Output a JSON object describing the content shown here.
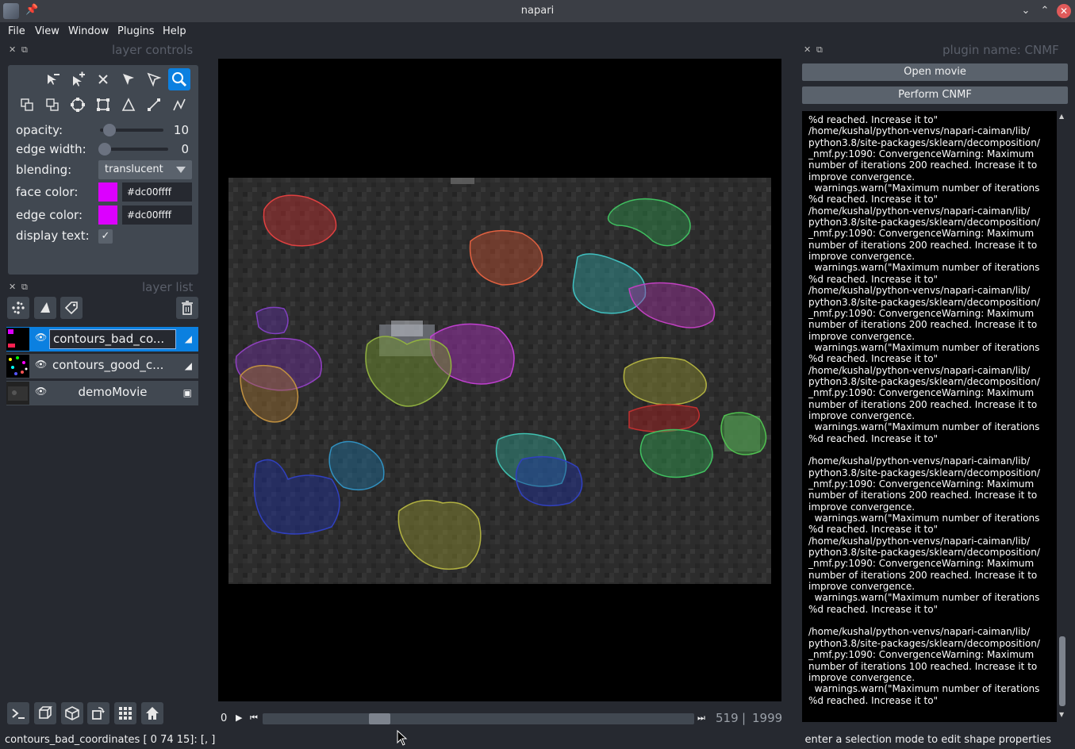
{
  "window": {
    "title": "napari"
  },
  "menu": [
    "File",
    "View",
    "Window",
    "Plugins",
    "Help"
  ],
  "layer_controls": {
    "dock_title": "layer controls",
    "opacity_label": "opacity:",
    "opacity_value": "10",
    "opacity_level": 0.1,
    "edge_width_label": "edge width:",
    "edge_width_value": "0",
    "blending_label": "blending:",
    "blending_value": "translucent",
    "face_color_label": "face color:",
    "face_color_value": "#dc00ffff",
    "edge_color_label": "edge color:",
    "edge_color_value": "#dc00ffff",
    "display_text_label": "display text:",
    "display_text_checked": true,
    "swatch_color": "#dc00ff"
  },
  "layer_list": {
    "dock_title": "layer list",
    "layers": [
      {
        "name": "contours_bad_co...",
        "selected": true,
        "visible": true,
        "type": "shapes-icon"
      },
      {
        "name": "contours_good_c...",
        "selected": false,
        "visible": true,
        "type": "shapes-icon"
      },
      {
        "name": "demoMovie",
        "selected": false,
        "visible": true,
        "type": "image-icon"
      }
    ]
  },
  "dims": {
    "axis_label": "0",
    "current": "519",
    "separator": "|",
    "max": "1999",
    "position_fraction": 0.26
  },
  "plugin": {
    "dock_title": "plugin  name: CNMF",
    "open_movie_label": "Open movie",
    "perform_cnmf_label": "Perform CNMF",
    "log_text": "%d reached. Increase it to\"\n/home/kushal/python-venvs/napari-caiman/lib/\npython3.8/site-packages/sklearn/decomposition/\n_nmf.py:1090: ConvergenceWarning: Maximum\nnumber of iterations 200 reached. Increase it to\nimprove convergence.\n  warnings.warn(\"Maximum number of iterations\n%d reached. Increase it to\"\n/home/kushal/python-venvs/napari-caiman/lib/\npython3.8/site-packages/sklearn/decomposition/\n_nmf.py:1090: ConvergenceWarning: Maximum\nnumber of iterations 200 reached. Increase it to\nimprove convergence.\n  warnings.warn(\"Maximum number of iterations\n%d reached. Increase it to\"\n/home/kushal/python-venvs/napari-caiman/lib/\npython3.8/site-packages/sklearn/decomposition/\n_nmf.py:1090: ConvergenceWarning: Maximum\nnumber of iterations 200 reached. Increase it to\nimprove convergence.\n  warnings.warn(\"Maximum number of iterations\n%d reached. Increase it to\"\n/home/kushal/python-venvs/napari-caiman/lib/\npython3.8/site-packages/sklearn/decomposition/\n_nmf.py:1090: ConvergenceWarning: Maximum\nnumber of iterations 200 reached. Increase it to\nimprove convergence.\n  warnings.warn(\"Maximum number of iterations\n%d reached. Increase it to\"\n\n/home/kushal/python-venvs/napari-caiman/lib/\npython3.8/site-packages/sklearn/decomposition/\n_nmf.py:1090: ConvergenceWarning: Maximum\nnumber of iterations 200 reached. Increase it to\nimprove convergence.\n  warnings.warn(\"Maximum number of iterations\n%d reached. Increase it to\"\n/home/kushal/python-venvs/napari-caiman/lib/\npython3.8/site-packages/sklearn/decomposition/\n_nmf.py:1090: ConvergenceWarning: Maximum\nnumber of iterations 200 reached. Increase it to\nimprove convergence.\n  warnings.warn(\"Maximum number of iterations\n%d reached. Increase it to\"\n\n/home/kushal/python-venvs/napari-caiman/lib/\npython3.8/site-packages/sklearn/decomposition/\n_nmf.py:1090: ConvergenceWarning: Maximum\nnumber of iterations 100 reached. Increase it to\nimprove convergence.\n  warnings.warn(\"Maximum number of iterations\n%d reached. Increase it to\""
  },
  "status": {
    "left": "contours_bad_coordinates [ 0 74 15]: [, ]",
    "right": "enter a selection mode to edit shape properties"
  },
  "colors": {
    "accent": "#0b80e0",
    "panel": "#414851",
    "background": "#262930"
  }
}
